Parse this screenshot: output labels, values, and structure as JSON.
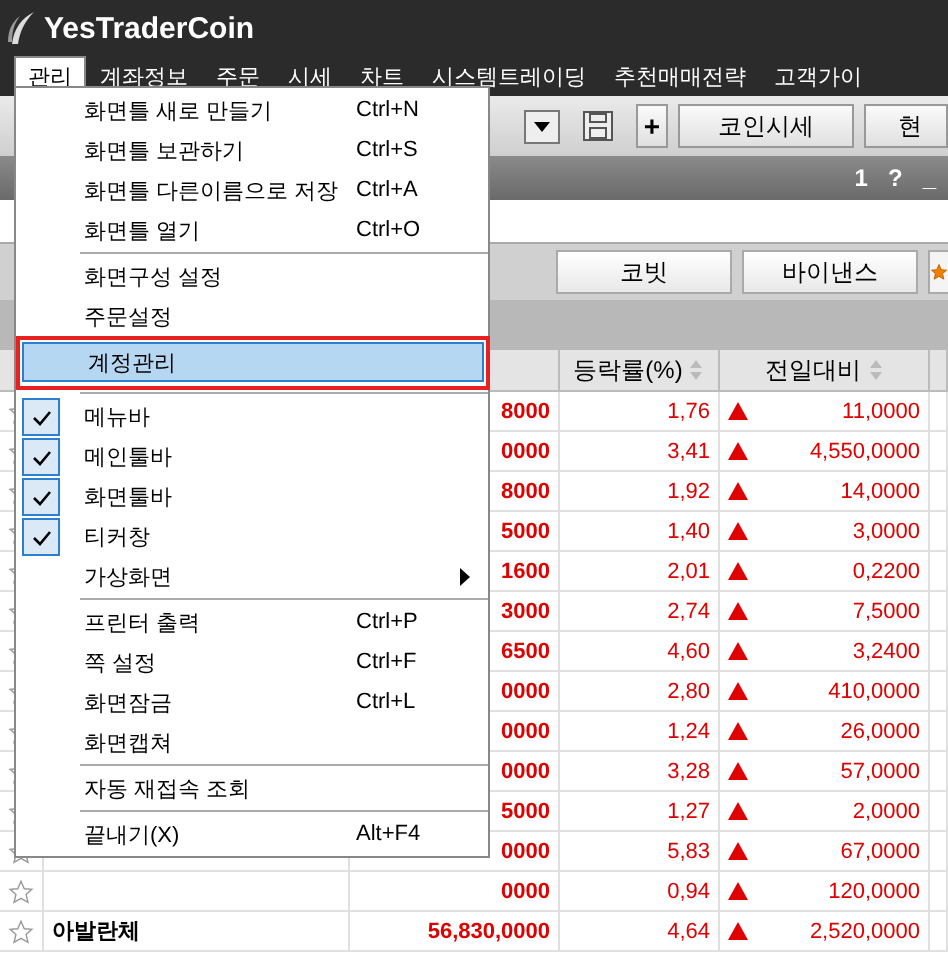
{
  "window": {
    "title": "YesTraderCoin"
  },
  "menubar": [
    {
      "label": "관리",
      "selected": true
    },
    {
      "label": "계좌정보",
      "selected": false
    },
    {
      "label": "주문",
      "selected": false
    },
    {
      "label": "시세",
      "selected": false
    },
    {
      "label": "차트",
      "selected": false
    },
    {
      "label": "시스템트레이딩",
      "selected": false
    },
    {
      "label": "추천매매전략",
      "selected": false
    },
    {
      "label": "고객가이",
      "selected": false
    }
  ],
  "toolbar": {
    "buttons": [
      "+",
      "코인시세",
      "현"
    ]
  },
  "panel": {
    "title_controls": [
      "1",
      "?",
      "_"
    ],
    "exchange_buttons": [
      "코빗",
      "바이낸스"
    ]
  },
  "table": {
    "columns": [
      "",
      "",
      "",
      "등락률(%)",
      "전일대비"
    ],
    "rows": [
      {
        "name": "",
        "price": "8000",
        "rate": "1,76",
        "change": "11,0000"
      },
      {
        "name": "",
        "price": "0000",
        "rate": "3,41",
        "change": "4,550,0000"
      },
      {
        "name": "",
        "price": "8000",
        "rate": "1,92",
        "change": "14,0000"
      },
      {
        "name": "",
        "price": "5000",
        "rate": "1,40",
        "change": "3,0000"
      },
      {
        "name": "",
        "price": "1600",
        "rate": "2,01",
        "change": "0,2200"
      },
      {
        "name": "",
        "price": "3000",
        "rate": "2,74",
        "change": "7,5000"
      },
      {
        "name": "",
        "price": "6500",
        "rate": "4,60",
        "change": "3,2400"
      },
      {
        "name": "",
        "price": "0000",
        "rate": "2,80",
        "change": "410,0000"
      },
      {
        "name": "",
        "price": "0000",
        "rate": "1,24",
        "change": "26,0000"
      },
      {
        "name": "",
        "price": "0000",
        "rate": "3,28",
        "change": "57,0000"
      },
      {
        "name": "",
        "price": "5000",
        "rate": "1,27",
        "change": "2,0000"
      },
      {
        "name": "",
        "price": "0000",
        "rate": "5,83",
        "change": "67,0000"
      },
      {
        "name": "",
        "price": "0000",
        "rate": "0,94",
        "change": "120,0000"
      },
      {
        "name": "아발란체",
        "price": "56,830,0000",
        "rate": "4,64",
        "change": "2,520,0000"
      }
    ]
  },
  "dropdown_menu": [
    {
      "kind": "item",
      "label": "화면틀 새로 만들기",
      "shortcut": "Ctrl+N"
    },
    {
      "kind": "item",
      "label": "화면틀 보관하기",
      "shortcut": "Ctrl+S"
    },
    {
      "kind": "item",
      "label": "화면틀 다른이름으로 저장",
      "shortcut": "Ctrl+A"
    },
    {
      "kind": "item",
      "label": "화면틀 열기",
      "shortcut": "Ctrl+O"
    },
    {
      "kind": "separator"
    },
    {
      "kind": "item",
      "label": "화면구성 설정"
    },
    {
      "kind": "item",
      "label": "주문설정"
    },
    {
      "kind": "item",
      "label": "계정관리",
      "highlighted": true,
      "outlined": true
    },
    {
      "kind": "separator"
    },
    {
      "kind": "check",
      "label": "메뉴바",
      "checked": true
    },
    {
      "kind": "check",
      "label": "메인툴바",
      "checked": true
    },
    {
      "kind": "check",
      "label": "화면툴바",
      "checked": true
    },
    {
      "kind": "check",
      "label": "티커창",
      "checked": true
    },
    {
      "kind": "submenu",
      "label": "가상화면"
    },
    {
      "kind": "separator"
    },
    {
      "kind": "item",
      "label": "프린터 출력",
      "shortcut": "Ctrl+P"
    },
    {
      "kind": "item",
      "label": "쪽 설정",
      "shortcut": "Ctrl+F"
    },
    {
      "kind": "item",
      "label": "화면잠금",
      "shortcut": "Ctrl+L"
    },
    {
      "kind": "item",
      "label": "화면캡쳐"
    },
    {
      "kind": "separator"
    },
    {
      "kind": "item",
      "label": "자동 재접속 조회"
    },
    {
      "kind": "separator"
    },
    {
      "kind": "item",
      "label": "끝내기(X)",
      "shortcut": "Alt+F4"
    }
  ]
}
